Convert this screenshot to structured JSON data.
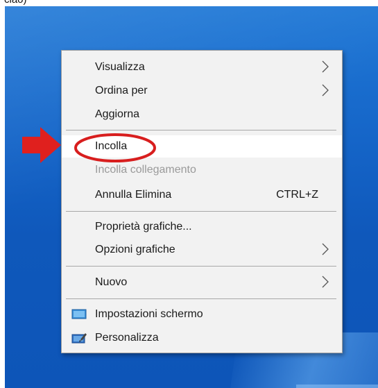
{
  "caption": "ciao)",
  "context_menu": {
    "items": [
      {
        "label": "Visualizza",
        "has_submenu": true
      },
      {
        "label": "Ordina per",
        "has_submenu": true
      },
      {
        "label": "Aggiorna"
      },
      {
        "label": "Incolla",
        "state": "highlighted"
      },
      {
        "label": "Incolla collegamento",
        "state": "disabled"
      },
      {
        "label": "Annulla Elimina",
        "shortcut": "CTRL+Z"
      },
      {
        "label": "Proprietà grafiche..."
      },
      {
        "label": "Opzioni grafiche",
        "has_submenu": true
      },
      {
        "label": "Nuovo",
        "has_submenu": true
      },
      {
        "label": "Impostazioni schermo",
        "icon": "display-settings-icon"
      },
      {
        "label": "Personalizza",
        "icon": "personalize-icon"
      }
    ]
  },
  "annotations": {
    "arrow_color": "#e0201e",
    "ellipse_color": "#d81e1e"
  },
  "colors": {
    "desktop_background": "#1565c8",
    "menu_background": "#f2f2f2",
    "highlight": "#ffffff"
  }
}
